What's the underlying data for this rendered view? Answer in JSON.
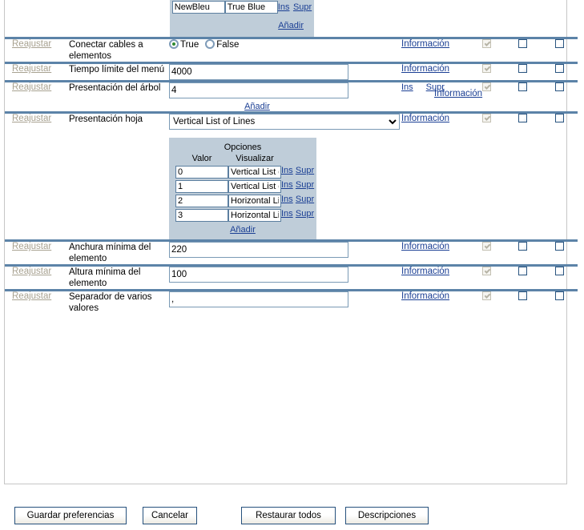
{
  "top_partial_table": {
    "rows": [
      {
        "value": "NewBleu",
        "display": "True Blue",
        "ins": "Ins",
        "supr": "Supr"
      }
    ],
    "add_label": "Añadir"
  },
  "common": {
    "reset_label": "Reajustar",
    "info_label": "Información",
    "ins_label": "Ins",
    "supr_label": "Supr",
    "add_label": "Añadir"
  },
  "rows": [
    {
      "id": "conectar-cables",
      "reset": "Reajustar",
      "label": "Conectar cables a elementos",
      "type": "radio",
      "radios": [
        {
          "label": "True",
          "selected": true
        },
        {
          "label": "False",
          "selected": false
        }
      ],
      "info": "Información"
    },
    {
      "id": "tiempo-limite-menu",
      "reset": "Reajustar",
      "label": "Tiempo límite del menú",
      "type": "text",
      "value": "4000",
      "info": "Información"
    },
    {
      "id": "presentacion-arbol",
      "reset": "Reajustar",
      "label": "Presentación del árbol",
      "type": "text-multi",
      "value": "4",
      "ins": "Ins",
      "supr": "Supr",
      "add": "Añadir",
      "info": "Información"
    },
    {
      "id": "presentacion-hoja",
      "reset": "Reajustar",
      "label": "Presentación hoja",
      "type": "select",
      "selected": "Vertical List of Lines",
      "options": [
        "Vertical List of Lines",
        "Vertical List of Boxes",
        "Horizontal List of Lines",
        "Horizontal List of Boxes"
      ],
      "info": "Información",
      "sub_table": {
        "title": "Opciones",
        "columns": [
          "Valor",
          "Visualizar"
        ],
        "rows": [
          {
            "value": "0",
            "display": "Vertical List of Lines",
            "ins": "Ins",
            "supr": "Supr"
          },
          {
            "value": "1",
            "display": "Vertical List of Boxes",
            "ins": "Ins",
            "supr": "Supr"
          },
          {
            "value": "2",
            "display": "Horizontal List of Lines",
            "ins": "Ins",
            "supr": "Supr"
          },
          {
            "value": "3",
            "display": "Horizontal List of Boxes",
            "ins": "Ins",
            "supr": "Supr"
          }
        ],
        "add_label": "Añadir"
      }
    },
    {
      "id": "anchura-minima",
      "reset": "Reajustar",
      "label": "Anchura mínima del elemento",
      "type": "text",
      "value": "220",
      "info": "Información"
    },
    {
      "id": "altura-minima",
      "reset": "Reajustar",
      "label": "Altura mínima del elemento",
      "type": "text",
      "value": "100",
      "info": "Información"
    },
    {
      "id": "separador-varios-valores",
      "reset": "Reajustar",
      "label": "Separador de varios valores",
      "type": "text",
      "value": ",",
      "info": "Información"
    }
  ],
  "footer": {
    "buttons": [
      {
        "id": "guardar-preferencias",
        "label": "Guardar preferencias"
      },
      {
        "id": "cancelar",
        "label": "Cancelar"
      },
      {
        "id": "restaurar-todos",
        "label": "Restaurar todos"
      },
      {
        "id": "descripciones",
        "label": "Descripciones"
      }
    ]
  },
  "colors": {
    "separator": "#5c83a8",
    "subtable_bg": "#bfcdd9",
    "link": "#1b3f94",
    "disabled_link": "#a8a291",
    "radio_dot": "#2f8a2f"
  }
}
